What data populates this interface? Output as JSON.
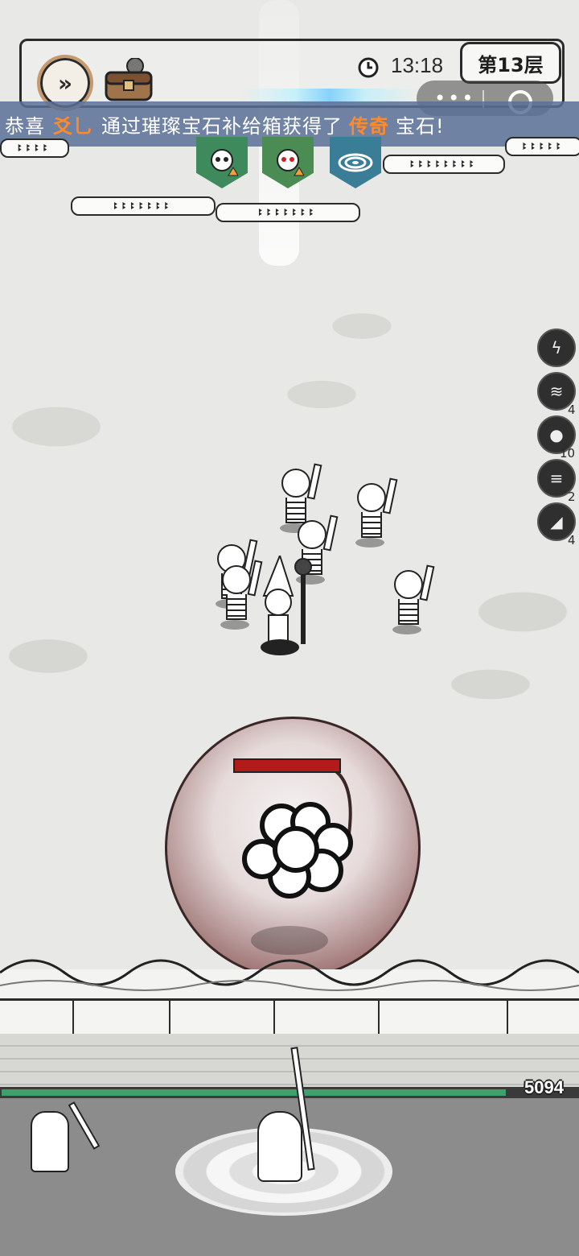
{
  "hud": {
    "speed_icon": "fast-forward-icon",
    "chest_icon": "treasure-chest-icon",
    "clock_icon": "clock-icon",
    "time": "13:18",
    "floor": "第13层"
  },
  "banner": {
    "prefix": "恭喜",
    "player": "爻乚",
    "middle": "通过璀璨宝石补给箱获得了",
    "item": "传奇",
    "suffix": "宝石!"
  },
  "enemy_hp_strips": [
    "ꔪꔪꔪꔪ",
    "ꔪꔪꔪꔪꔪꔪꔪ",
    "ꔪꔪꔪꔪꔪꔪꔪ",
    "ꔪꔪꔪꔪꔪꔪꔪꔪꔪꔪ",
    "ꔪꔪꔪꔪꔪꔪꔪꔪ",
    "ꔪꔪꔪꔪꔪ"
  ],
  "buffs": [
    {
      "icon": "skull-up-icon",
      "color": "#3f8a5c"
    },
    {
      "icon": "red-skull-up-icon",
      "color": "#4a8c53"
    },
    {
      "icon": "vortex-icon",
      "color": "#3a7d96"
    }
  ],
  "skills": [
    {
      "icon": "lightning-skill-icon",
      "count": ""
    },
    {
      "icon": "claw-skill-icon",
      "count": "4"
    },
    {
      "icon": "bomb-skill-icon",
      "count": "10"
    },
    {
      "icon": "tornado-skill-icon",
      "count": "2"
    },
    {
      "icon": "blade-skill-icon",
      "count": "4"
    }
  ],
  "wall_hp": {
    "value": "5094",
    "fraction": 0.875
  },
  "colors": {
    "banner_highlight": "#ff8a2a",
    "hp_bar": "#3fa06c",
    "boss_hp": "#b31a1a"
  }
}
